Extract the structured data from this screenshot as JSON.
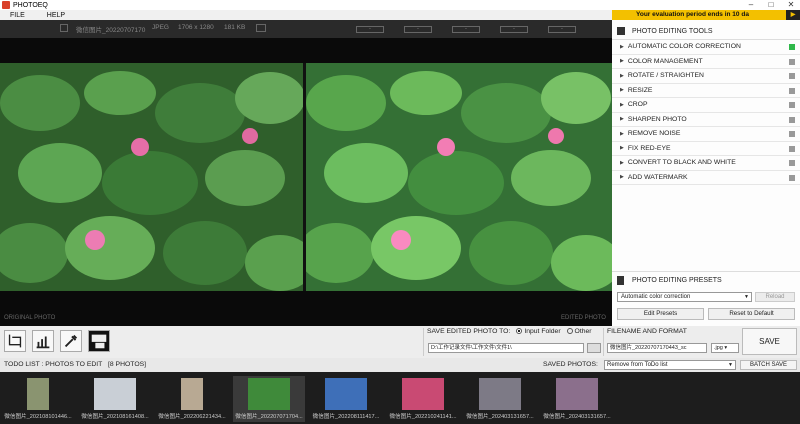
{
  "window": {
    "title": "PHOTOEQ",
    "minimize": "–",
    "maximize": "□",
    "close": "✕"
  },
  "menu": {
    "file": "FILE",
    "help": "HELP"
  },
  "trial_banner": "Your evaluation period ends in 10 da",
  "trial_arrow": "▶",
  "toolbar": {
    "filename": "微信图片_20220707170",
    "format": "JPEG",
    "dimensions": "1706 x 1280",
    "size": "181 KB",
    "boxes": [
      "-",
      "-",
      "-",
      "-",
      "-"
    ]
  },
  "viewer": {
    "original_label": "ORIGINAL PHOTO",
    "edited_label": "EDITED PHOTO"
  },
  "panel": {
    "tools_title": "PHOTO EDITING TOOLS",
    "tools": [
      {
        "label": "AUTOMATIC COLOR CORRECTION",
        "active": true
      },
      {
        "label": "COLOR MANAGEMENT",
        "active": false
      },
      {
        "label": "ROTATE / STRAIGHTEN",
        "active": false
      },
      {
        "label": "RESIZE",
        "active": false
      },
      {
        "label": "CROP",
        "active": false
      },
      {
        "label": "SHARPEN PHOTO",
        "active": false
      },
      {
        "label": "REMOVE NOISE",
        "active": false
      },
      {
        "label": "FIX RED-EYE",
        "active": false
      },
      {
        "label": "CONVERT TO BLACK AND WHITE",
        "active": false
      },
      {
        "label": "ADD WATERMARK",
        "active": false
      }
    ],
    "presets_title": "PHOTO EDITING PRESETS",
    "preset_value": "Automatic color correction",
    "reload": "Reload",
    "edit_presets": "Edit Presets",
    "reset_default": "Reset to Default"
  },
  "save": {
    "save_to_label": "SAVE EDITED PHOTO TO:",
    "input_folder": "Input Folder",
    "other": "Other",
    "path": "D:\\工作记录文件\\工作文件\\文件1\\",
    "filename_label": "FILENAME AND FORMAT",
    "filename": "微信图片_20220707170443_sc",
    "extension": ".jpg",
    "save_button": "SAVE"
  },
  "todo": {
    "title": "TODO LIST : PHOTOS TO EDIT",
    "count": "[8 PHOTOS]",
    "saved_label": "SAVED PHOTOS:",
    "saved_option": "Remove from ToDo list",
    "batch_save": "BATCH SAVE"
  },
  "thumbnails": [
    {
      "caption": "微信图片_202108101446...",
      "color": "#8a9470"
    },
    {
      "caption": "微信图片_202108161408...",
      "color": "#c9cfd6"
    },
    {
      "caption": "微信图片_202206221434...",
      "color": "#b8a993"
    },
    {
      "caption": "微信图片_202207071704...",
      "color": "#3f8a3a"
    },
    {
      "caption": "微信图片_202208111417...",
      "color": "#3e6fb8"
    },
    {
      "caption": "微信图片_202210241141...",
      "color": "#c94a73"
    },
    {
      "caption": "微信图片_202403131657...",
      "color": "#7d7a86"
    },
    {
      "caption": "微信图片_202403131657...",
      "color": "#8b6f8c"
    }
  ]
}
